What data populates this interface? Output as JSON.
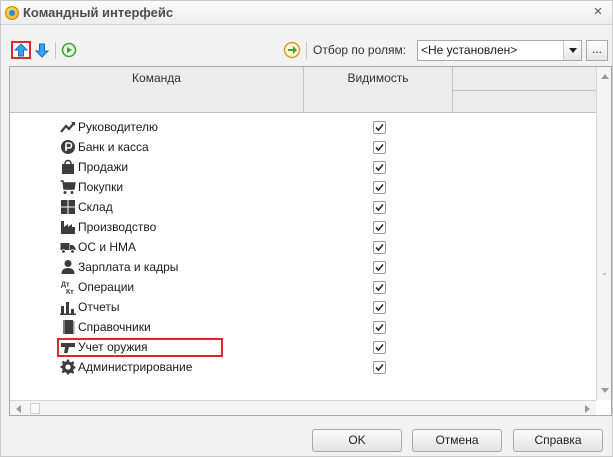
{
  "window": {
    "title": "Командный интерфейс",
    "close_glyph": "×"
  },
  "toolbar": {
    "move_up_icon": "arrow-up-icon",
    "move_down_icon": "arrow-down-icon",
    "refresh_icon": "refresh-icon",
    "apply_icon": "apply-icon",
    "role_filter_label": "Отбор по ролям:",
    "role_filter_value": "<Не установлен>",
    "more_button_label": "..."
  },
  "grid": {
    "columns": {
      "command": "Команда",
      "visibility": "Видимость"
    },
    "rows": [
      {
        "label": "Руководителю",
        "icon": "chart-trend-icon",
        "visible": true
      },
      {
        "label": "Банк и касса",
        "icon": "bank-coin-icon",
        "visible": true
      },
      {
        "label": "Продажи",
        "icon": "shopping-bag-icon",
        "visible": true
      },
      {
        "label": "Покупки",
        "icon": "shopping-cart-icon",
        "visible": true
      },
      {
        "label": "Склад",
        "icon": "warehouse-icon",
        "visible": true
      },
      {
        "label": "Производство",
        "icon": "factory-icon",
        "visible": true
      },
      {
        "label": "ОС и НМА",
        "icon": "truck-icon",
        "visible": true
      },
      {
        "label": "Зарплата и кадры",
        "icon": "person-icon",
        "visible": true
      },
      {
        "label": "Операции",
        "icon": "debit-credit-icon",
        "visible": true
      },
      {
        "label": "Отчеты",
        "icon": "bar-chart-icon",
        "visible": true
      },
      {
        "label": "Справочники",
        "icon": "book-icon",
        "visible": true
      },
      {
        "label": "Учет оружия",
        "icon": "pistol-icon",
        "visible": true,
        "highlighted": true
      },
      {
        "label": "Администрирование",
        "icon": "gear-icon",
        "visible": true
      }
    ]
  },
  "buttons": {
    "ok": "OK",
    "cancel": "Отмена",
    "help": "Справка"
  },
  "colors": {
    "highlight": "#e0282c",
    "icon_dark": "#3c3c3c",
    "up_arrow": "#2f8ad8"
  }
}
